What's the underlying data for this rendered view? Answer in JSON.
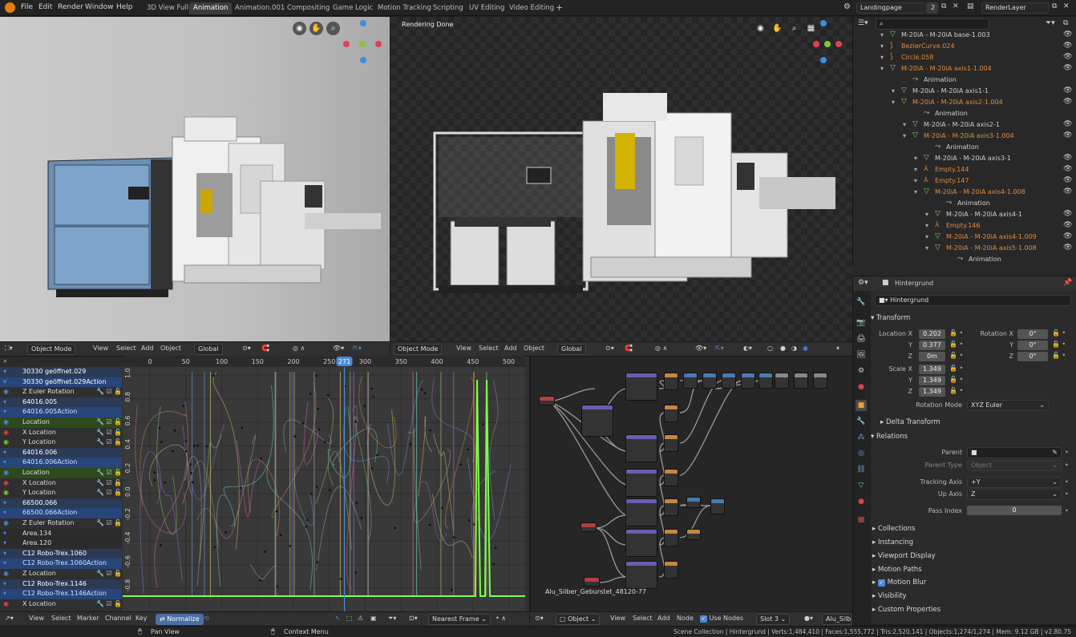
{
  "menu": [
    "File",
    "Edit",
    "Render",
    "Window",
    "Help"
  ],
  "workspaces": [
    "3D View Full",
    "Animation",
    "Animation.001",
    "Compositing",
    "Game Logic",
    "Motion Tracking",
    "Scripting",
    "UV Editing",
    "Video Editing"
  ],
  "workspace_add": "+",
  "scene": {
    "name": "Landingpage",
    "users": "2"
  },
  "view_layer": "RenderLayer",
  "viewport_right": {
    "status": "Rendering Done"
  },
  "gizmo_axes": {
    "x": "X",
    "y": "Y",
    "z": "Z",
    "x_color": "#e4404f",
    "y_color": "#85c62d",
    "z_color": "#3a8ee6"
  },
  "outliner": {
    "search_placeholder": "",
    "rows": [
      {
        "label": "M-20iA - M-20iA base-1.003",
        "color": "#cfcfcf",
        "indent": 0
      },
      {
        "label": "BezierCurve.024",
        "color": "#e28b3c",
        "indent": 0
      },
      {
        "label": "Circle.058",
        "color": "#e28b3c",
        "indent": 0
      },
      {
        "label": "M-20iA - M-20iA axis1-1.004",
        "color": "#e28b3c",
        "indent": 0
      },
      {
        "label": "Animation",
        "color": "#cfcfcf",
        "indent": 1
      },
      {
        "label": "M-20iA - M-20iA axis1-1",
        "color": "#cfcfcf",
        "indent": 1
      },
      {
        "label": "M-20iA - M-20iA axis2-1.004",
        "color": "#e28b3c",
        "indent": 1
      },
      {
        "label": "Animation",
        "color": "#cfcfcf",
        "indent": 2
      },
      {
        "label": "M-20iA - M-20iA axis2-1",
        "color": "#cfcfcf",
        "indent": 2
      },
      {
        "label": "M-20iA - M-20iA axis3-1.004",
        "color": "#e28b3c",
        "indent": 2
      },
      {
        "label": "Animation",
        "color": "#cfcfcf",
        "indent": 3
      },
      {
        "label": "M-20iA - M-20iA axis3-1",
        "color": "#cfcfcf",
        "indent": 3
      },
      {
        "label": "Empty.144",
        "color": "#e28b3c",
        "indent": 3
      },
      {
        "label": "Empty.147",
        "color": "#e28b3c",
        "indent": 3
      },
      {
        "label": "M-20iA - M-20iA axis4-1.008",
        "color": "#e28b3c",
        "indent": 3
      },
      {
        "label": "Animation",
        "color": "#cfcfcf",
        "indent": 4
      },
      {
        "label": "M-20iA - M-20iA axis4-1",
        "color": "#cfcfcf",
        "indent": 4
      },
      {
        "label": "Empty.146",
        "color": "#e28b3c",
        "indent": 4
      },
      {
        "label": "M-20iA - M-20iA axis4-1.009",
        "color": "#e28b3c",
        "indent": 4
      },
      {
        "label": "M-20iA - M-20iA axis5-1.008",
        "color": "#e28b3c",
        "indent": 4
      },
      {
        "label": "Animation",
        "color": "#cfcfcf",
        "indent": 5
      },
      {
        "label": "M-20iA - M-20iA axis5-1",
        "color": "#cfcfcf",
        "indent": 5
      }
    ]
  },
  "properties": {
    "object_name": "Hintergrund",
    "object_field": "Hintergrund",
    "transform": {
      "title": "Transform",
      "location_label": "Location X",
      "loc_x": "0.202",
      "y_label": "Y",
      "loc_y": "0.377",
      "z_label": "Z",
      "loc_z": "0m",
      "rotation_label": "Rotation X",
      "rot_x": "0°",
      "rot_y": "0°",
      "rot_z": "0°",
      "scale_label": "Scale X",
      "scale_x": "1.349",
      "scale_y": "1.349",
      "scale_z": "1.349",
      "rotation_mode_label": "Rotation Mode",
      "rotation_mode": "XYZ Euler"
    },
    "delta_transform": "Delta Transform",
    "relations": {
      "title": "Relations",
      "parent_label": "Parent",
      "parent_type_label": "Parent Type",
      "parent_type": "Object",
      "tracking_axis_label": "Tracking Axis",
      "tracking_axis": "+Y",
      "up_axis_label": "Up Axis",
      "up_axis": "Z",
      "pass_index_label": "Pass Index",
      "pass_index": "0"
    },
    "panels": [
      "Collections",
      "Instancing",
      "Viewport Display",
      "Motion Paths",
      "Motion Blur",
      "Visibility",
      "Custom Properties"
    ]
  },
  "viewport_header": {
    "mode": "Object Mode",
    "view": "View",
    "select": "Select",
    "add": "Add",
    "object": "Object",
    "orientation": "Global"
  },
  "graph": {
    "frame_ticks": [
      "0",
      "50",
      "100",
      "150",
      "200",
      "250",
      "271",
      "300",
      "350",
      "400",
      "450",
      "500"
    ],
    "current_frame": "271",
    "value_ticks": [
      "1.0",
      "0.8",
      "0.6",
      "0.4",
      "0.2",
      "0.0",
      "-0.2",
      "-0.4",
      "-0.6",
      "-0.8"
    ],
    "channels": [
      {
        "label": "30330 geöffnet.029",
        "bg": "#2b3a55",
        "color": "#fff"
      },
      {
        "label": "30330 geöffnet.029Action",
        "bg": "#28457a",
        "color": "#fff"
      },
      {
        "label": "Z Euler Rotation",
        "bg": "#2f2f2f",
        "color": "#ddd"
      },
      {
        "label": "64016.005",
        "bg": "#2b3a55",
        "color": "#fff"
      },
      {
        "label": "64016.005Action",
        "bg": "#28457a",
        "color": "#cfe0ff"
      },
      {
        "label": "Location",
        "bg": "#2d4a1f",
        "color": "#ddd"
      },
      {
        "label": "X Location",
        "bg": "#2f2f2f",
        "color": "#ddd"
      },
      {
        "label": "Y Location",
        "bg": "#2f2f2f",
        "color": "#ddd"
      },
      {
        "label": "64016.006",
        "bg": "#2b3a55",
        "color": "#fff"
      },
      {
        "label": "64016.006Action",
        "bg": "#28457a",
        "color": "#cfe0ff"
      },
      {
        "label": "Location",
        "bg": "#2d4a1f",
        "color": "#ddd"
      },
      {
        "label": "X Location",
        "bg": "#2f2f2f",
        "color": "#ddd"
      },
      {
        "label": "Y Location",
        "bg": "#2f2f2f",
        "color": "#ddd"
      },
      {
        "label": "66500.066",
        "bg": "#2b3a55",
        "color": "#fff"
      },
      {
        "label": "66500.066Action",
        "bg": "#28457a",
        "color": "#cfe0ff"
      },
      {
        "label": "Z Euler Rotation",
        "bg": "#2f2f2f",
        "color": "#ddd"
      },
      {
        "label": "Area.134",
        "bg": "#2b2b2b",
        "color": "#ddd"
      },
      {
        "label": "Area.120",
        "bg": "#2b2b2b",
        "color": "#ddd"
      },
      {
        "label": "C12 Robo-Trex.1060",
        "bg": "#2b3a55",
        "color": "#fff"
      },
      {
        "label": "C12 Robo-Trex.1060Action",
        "bg": "#28457a",
        "color": "#cfe0ff"
      },
      {
        "label": "Z Location",
        "bg": "#2f2f2f",
        "color": "#ddd"
      },
      {
        "label": "C12 Robo-Trex.1146",
        "bg": "#2b3a55",
        "color": "#fff"
      },
      {
        "label": "C12 Robo-Trex.1146Action",
        "bg": "#28457a",
        "color": "#cfe0ff"
      },
      {
        "label": "X Location",
        "bg": "#2f2f2f",
        "color": "#ddd"
      }
    ],
    "footer": {
      "view": "View",
      "select": "Select",
      "marker": "Marker",
      "channel": "Channel",
      "key": "Key",
      "normalize": "Normalize",
      "snap": "Nearest Frame"
    }
  },
  "nodes": {
    "material_label": "Alu_Silber_Geburstet_48120-77",
    "footer": {
      "object": "Object",
      "view": "View",
      "select": "Select",
      "add": "Add",
      "node": "Node",
      "use_nodes": "Use Nodes",
      "slot": "Slot 3",
      "material": "Alu_Silbe"
    }
  },
  "statusbar": {
    "pan": "Pan View",
    "context": "Context Menu",
    "info": "Scene Collection | Hintergrund | Verts:1,484,410 | Faces:1,555,772 | Tris:2,520,141 | Objects:1,274/1,274 | Mem: 9.12 GB | v2.80.75"
  }
}
